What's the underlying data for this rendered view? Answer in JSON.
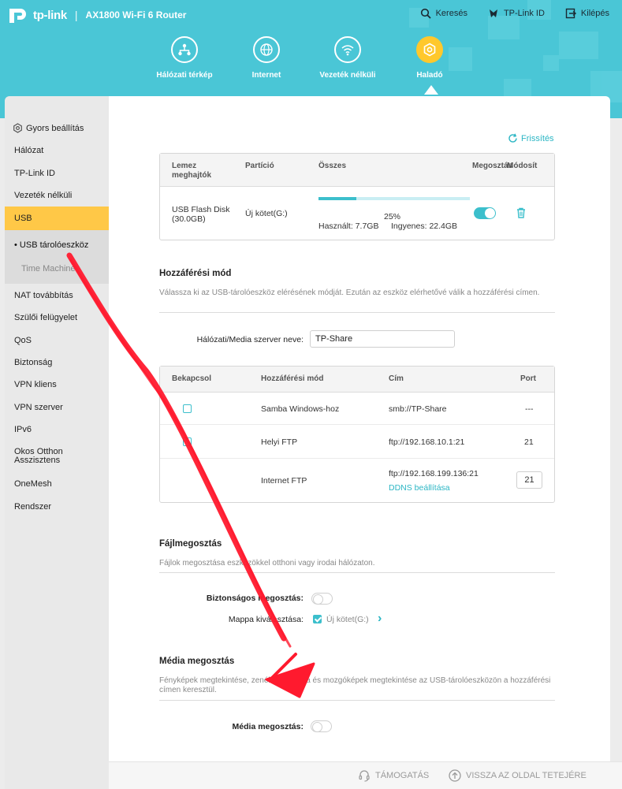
{
  "header": {
    "brand": "tp-link",
    "model": "AX1800 Wi-Fi 6 Router",
    "links": [
      {
        "label": "Keresés",
        "icon": "search-icon"
      },
      {
        "label": "TP-Link ID",
        "icon": "user-icon"
      },
      {
        "label": "Kilépés",
        "icon": "logout-icon"
      }
    ],
    "nav": [
      {
        "label": "Hálózati térkép",
        "icon": "network-map-icon"
      },
      {
        "label": "Internet",
        "icon": "globe-icon"
      },
      {
        "label": "Vezeték nélküli",
        "icon": "wifi-icon"
      },
      {
        "label": "Haladó",
        "icon": "advanced-gear-icon",
        "active": true
      }
    ]
  },
  "sidebar": {
    "items": [
      "Gyors beállítás",
      "Hálózat",
      "TP-Link ID",
      "Vezeték nélküli",
      "USB",
      "NAT továbbítás",
      "Szülői felügyelet",
      "QoS",
      "Biztonság",
      "VPN kliens",
      "VPN szerver",
      "IPv6",
      "Okos Otthon Asszisztens",
      "OneMesh",
      "Rendszer"
    ],
    "usb_sub": [
      "USB tárolóeszköz",
      "Time Machine"
    ]
  },
  "refresh_label": "Frissítés",
  "disk_table": {
    "headers": [
      "Lemez meghajtók",
      "Partíció",
      "Összes",
      "Megosztás",
      "Módosít"
    ],
    "row": {
      "drive": "USB   Flash Disk (30.0GB)",
      "partition": "Új kötet(G:)",
      "percent": "25%",
      "used": "Használt: 7.7GB",
      "free": "Ingyenes: 22.4GB",
      "usage_fraction": 0.25
    }
  },
  "access": {
    "title": "Hozzáférési mód",
    "desc": "Válassza ki az USB-tárolóeszköz elérésének módját. Ezután az eszköz elérhetővé válik a hozzáférési címen.",
    "server_label": "Hálózati/Media szerver neve:",
    "server_value": "TP-Share",
    "headers": [
      "Bekapcsol",
      "Hozzáférési mód",
      "Cím",
      "Port"
    ],
    "rows": [
      {
        "mode": "Samba Windows-hoz",
        "address": "smb://TP-Share",
        "port": "---"
      },
      {
        "mode": "Helyi FTP",
        "address": "ftp://192.168.10.1:21",
        "port": "21"
      },
      {
        "mode": "Internet FTP",
        "address": "ftp://192.168.199.136:21",
        "port": "21",
        "link": "DDNS beállítása"
      }
    ]
  },
  "file_share": {
    "title": "Fájlmegosztás",
    "desc": "Fájlok megosztása eszközökkel otthoni vagy irodai hálózaton.",
    "secure_label": "Biztonságos megosztás:",
    "folder_label": "Mappa kiválasztása:",
    "folder_value": "Új kötet(G:)"
  },
  "media_share": {
    "title": "Média megosztás",
    "desc": "Fényképek megtekintése, zenék hallgatása és mozgóképek megtekintése az USB-tárolóeszközön a hozzáférési címen keresztül.",
    "label": "Média megosztás:"
  },
  "footer": {
    "support": "TÁMOGATÁS",
    "back_to_top": "VISSZA AZ OLDAL TETEJÉRE"
  },
  "colors": {
    "header": "#4ac6d6",
    "accent": "#3cbfcc",
    "active_nav": "#ffc82c",
    "annotation": "#ff1a2e"
  }
}
